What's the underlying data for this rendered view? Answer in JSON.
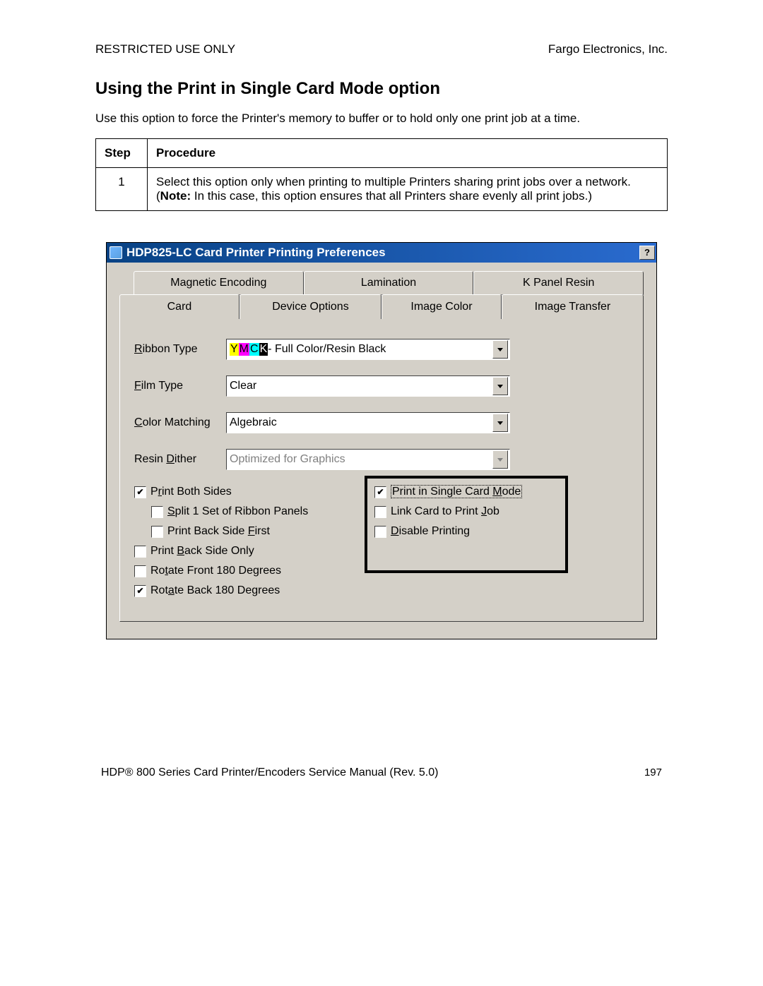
{
  "header": {
    "left": "RESTRICTED USE ONLY",
    "right": "Fargo Electronics, Inc."
  },
  "section_title": "Using the Print in Single Card Mode option",
  "intro": "Use this option to force the Printer's memory to buffer or to hold only one print job at a time.",
  "table": {
    "headers": {
      "step": "Step",
      "procedure": "Procedure"
    },
    "rows": [
      {
        "num": "1",
        "text_a": "Select this option only when printing to multiple Printers sharing print jobs over a network. (",
        "note_label": "Note:",
        "text_b": "  In this case, this option ensures that all Printers share evenly all print jobs.)"
      }
    ]
  },
  "dialog": {
    "title": "HDP825-LC Card Printer Printing Preferences",
    "help": "?",
    "tabs_row1": [
      "Magnetic Encoding",
      "Lamination",
      "K Panel Resin"
    ],
    "tabs_row2": [
      "Card",
      "Device Options",
      "Image Color",
      "Image Transfer"
    ],
    "active_tab": 1,
    "fields": {
      "ribbon_label_pre": "R",
      "ribbon_label_post": "ibbon Type",
      "ribbon_value_tail": " - Full Color/Resin Black",
      "ymck": {
        "y": "Y",
        "m": "M",
        "c": "C",
        "k": "K"
      },
      "film_label_pre": "F",
      "film_label_post": "ilm Type",
      "film_value": "Clear",
      "color_label_pre": "C",
      "color_label_post": "olor Matching",
      "color_value": "Algebraic",
      "dither_label_pre": "Resin D",
      "dither_label_post": "ither",
      "dither_underline": "D",
      "dither_value": "Optimized for Graphics"
    },
    "checks_left": [
      {
        "pre": "P",
        "u": "r",
        "post": "int Both Sides",
        "checked": true,
        "indent": false
      },
      {
        "pre": "",
        "u": "S",
        "post": "plit 1 Set of Ribbon Panels",
        "checked": false,
        "indent": true
      },
      {
        "pre": "Print Back Side ",
        "u": "F",
        "post": "irst",
        "checked": false,
        "indent": true
      },
      {
        "pre": "Print ",
        "u": "B",
        "post": "ack Side Only",
        "checked": false,
        "indent": false
      },
      {
        "pre": "Ro",
        "u": "t",
        "post": "ate Front 180 Degrees",
        "checked": false,
        "indent": false
      },
      {
        "pre": "Rot",
        "u": "a",
        "post": "te Back 180 Degrees",
        "checked": true,
        "indent": false
      }
    ],
    "checks_right": [
      {
        "pre": "Print in Single Card ",
        "u": "M",
        "post": "ode",
        "checked": true,
        "focus": true
      },
      {
        "pre": "Link Card to Print ",
        "u": "J",
        "post": "ob",
        "checked": false,
        "focus": false
      },
      {
        "pre": "",
        "u": "D",
        "post": "isable Printing",
        "checked": false,
        "focus": false
      }
    ]
  },
  "footer": {
    "left_a": "HDP",
    "left_b": " 800 Series Card Printer/Encoders Service Manual (Rev. 5.0)",
    "page": "197"
  }
}
